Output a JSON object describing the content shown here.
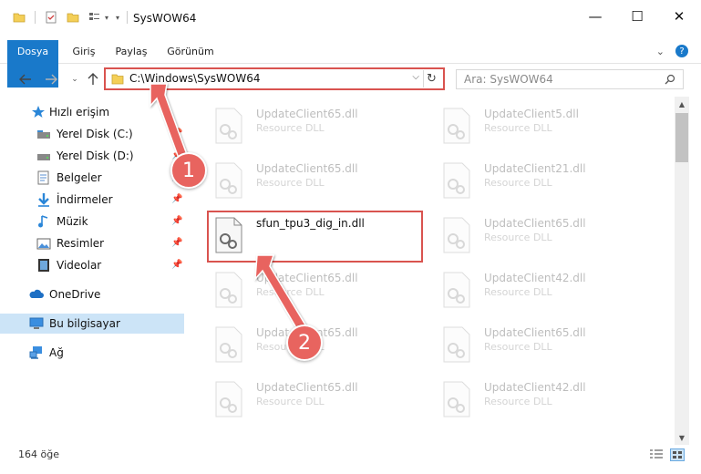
{
  "window": {
    "title": "SysWOW64",
    "minimize": "—",
    "maximize": "☐",
    "close": "✕"
  },
  "ribbon": {
    "tabs": [
      "Dosya",
      "Giriş",
      "Paylaş",
      "Görünüm"
    ],
    "help": "?"
  },
  "address": {
    "path": "C:\\Windows\\SysWOW64",
    "chevron": "⌵",
    "refresh": "↻"
  },
  "search": {
    "placeholder": "Ara: SysWOW64"
  },
  "sidebar": {
    "items": [
      {
        "label": "Hızlı erişim",
        "icon": "star-icon"
      },
      {
        "label": "Yerel Disk (C:)",
        "icon": "drive-icon"
      },
      {
        "label": "Yerel Disk (D:)",
        "icon": "drive-icon"
      },
      {
        "label": "Belgeler",
        "icon": "documents-icon"
      },
      {
        "label": "İndirmeler",
        "icon": "download-icon"
      },
      {
        "label": "Müzik",
        "icon": "music-icon"
      },
      {
        "label": "Resimler",
        "icon": "pictures-icon"
      },
      {
        "label": "Videolar",
        "icon": "videos-icon"
      },
      {
        "label": "OneDrive",
        "icon": "cloud-icon"
      },
      {
        "label": "Bu bilgisayar",
        "icon": "computer-icon"
      },
      {
        "label": "Ağ",
        "icon": "network-icon"
      }
    ]
  },
  "files": {
    "col1": [
      {
        "name": "UpdateClient65.dll",
        "type": "Resource DLL"
      },
      {
        "name": "UpdateClient65.dll",
        "type": "Resource DLL"
      },
      {
        "name": "sfun_tpu3_dig_in.dll",
        "type": ""
      },
      {
        "name": "UpdateClient65.dll",
        "type": "Resource DLL"
      },
      {
        "name": "UpdateClient65.dll",
        "type": "Resource DLL"
      },
      {
        "name": "UpdateClient65.dll",
        "type": "Resource DLL"
      }
    ],
    "col2": [
      {
        "name": "UpdateClient5.dll",
        "type": "Resource DLL"
      },
      {
        "name": "UpdateClient21.dll",
        "type": "Resource DLL"
      },
      {
        "name": "UpdateClient65.dll",
        "type": "Resource DLL"
      },
      {
        "name": "UpdateClient42.dll",
        "type": "Resource DLL"
      },
      {
        "name": "UpdateClient65.dll",
        "type": "Resource DLL"
      },
      {
        "name": "UpdateClient42.dll",
        "type": "Resource DLL"
      }
    ]
  },
  "status": {
    "count": "164 öğe"
  },
  "annotations": {
    "step1": "1",
    "step2": "2",
    "color": "#e8645f"
  }
}
